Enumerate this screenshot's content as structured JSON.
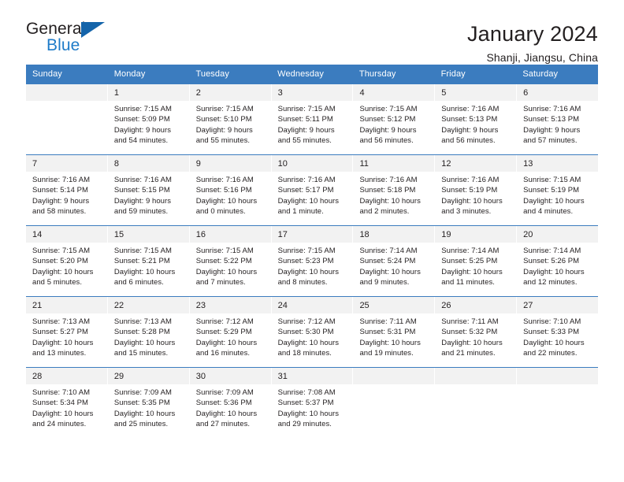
{
  "brand": {
    "name_part1": "General",
    "name_part2": "Blue",
    "triangle_color": "#1464aa",
    "blue_color": "#1e7bc8"
  },
  "header": {
    "title": "January 2024",
    "subtitle": "Shanji, Jiangsu, China"
  },
  "theme": {
    "header_blue": "#3b7cbf",
    "day_band_gray": "#f2f2f2",
    "text_color": "#231f20"
  },
  "weekdays": [
    "Sunday",
    "Monday",
    "Tuesday",
    "Wednesday",
    "Thursday",
    "Friday",
    "Saturday"
  ],
  "weeks": [
    [
      {
        "day": "",
        "sunrise": "",
        "sunset": "",
        "daylight_line1": "",
        "daylight_line2": ""
      },
      {
        "day": "1",
        "sunrise": "Sunrise: 7:15 AM",
        "sunset": "Sunset: 5:09 PM",
        "daylight_line1": "Daylight: 9 hours",
        "daylight_line2": "and 54 minutes."
      },
      {
        "day": "2",
        "sunrise": "Sunrise: 7:15 AM",
        "sunset": "Sunset: 5:10 PM",
        "daylight_line1": "Daylight: 9 hours",
        "daylight_line2": "and 55 minutes."
      },
      {
        "day": "3",
        "sunrise": "Sunrise: 7:15 AM",
        "sunset": "Sunset: 5:11 PM",
        "daylight_line1": "Daylight: 9 hours",
        "daylight_line2": "and 55 minutes."
      },
      {
        "day": "4",
        "sunrise": "Sunrise: 7:15 AM",
        "sunset": "Sunset: 5:12 PM",
        "daylight_line1": "Daylight: 9 hours",
        "daylight_line2": "and 56 minutes."
      },
      {
        "day": "5",
        "sunrise": "Sunrise: 7:16 AM",
        "sunset": "Sunset: 5:13 PM",
        "daylight_line1": "Daylight: 9 hours",
        "daylight_line2": "and 56 minutes."
      },
      {
        "day": "6",
        "sunrise": "Sunrise: 7:16 AM",
        "sunset": "Sunset: 5:13 PM",
        "daylight_line1": "Daylight: 9 hours",
        "daylight_line2": "and 57 minutes."
      }
    ],
    [
      {
        "day": "7",
        "sunrise": "Sunrise: 7:16 AM",
        "sunset": "Sunset: 5:14 PM",
        "daylight_line1": "Daylight: 9 hours",
        "daylight_line2": "and 58 minutes."
      },
      {
        "day": "8",
        "sunrise": "Sunrise: 7:16 AM",
        "sunset": "Sunset: 5:15 PM",
        "daylight_line1": "Daylight: 9 hours",
        "daylight_line2": "and 59 minutes."
      },
      {
        "day": "9",
        "sunrise": "Sunrise: 7:16 AM",
        "sunset": "Sunset: 5:16 PM",
        "daylight_line1": "Daylight: 10 hours",
        "daylight_line2": "and 0 minutes."
      },
      {
        "day": "10",
        "sunrise": "Sunrise: 7:16 AM",
        "sunset": "Sunset: 5:17 PM",
        "daylight_line1": "Daylight: 10 hours",
        "daylight_line2": "and 1 minute."
      },
      {
        "day": "11",
        "sunrise": "Sunrise: 7:16 AM",
        "sunset": "Sunset: 5:18 PM",
        "daylight_line1": "Daylight: 10 hours",
        "daylight_line2": "and 2 minutes."
      },
      {
        "day": "12",
        "sunrise": "Sunrise: 7:16 AM",
        "sunset": "Sunset: 5:19 PM",
        "daylight_line1": "Daylight: 10 hours",
        "daylight_line2": "and 3 minutes."
      },
      {
        "day": "13",
        "sunrise": "Sunrise: 7:15 AM",
        "sunset": "Sunset: 5:19 PM",
        "daylight_line1": "Daylight: 10 hours",
        "daylight_line2": "and 4 minutes."
      }
    ],
    [
      {
        "day": "14",
        "sunrise": "Sunrise: 7:15 AM",
        "sunset": "Sunset: 5:20 PM",
        "daylight_line1": "Daylight: 10 hours",
        "daylight_line2": "and 5 minutes."
      },
      {
        "day": "15",
        "sunrise": "Sunrise: 7:15 AM",
        "sunset": "Sunset: 5:21 PM",
        "daylight_line1": "Daylight: 10 hours",
        "daylight_line2": "and 6 minutes."
      },
      {
        "day": "16",
        "sunrise": "Sunrise: 7:15 AM",
        "sunset": "Sunset: 5:22 PM",
        "daylight_line1": "Daylight: 10 hours",
        "daylight_line2": "and 7 minutes."
      },
      {
        "day": "17",
        "sunrise": "Sunrise: 7:15 AM",
        "sunset": "Sunset: 5:23 PM",
        "daylight_line1": "Daylight: 10 hours",
        "daylight_line2": "and 8 minutes."
      },
      {
        "day": "18",
        "sunrise": "Sunrise: 7:14 AM",
        "sunset": "Sunset: 5:24 PM",
        "daylight_line1": "Daylight: 10 hours",
        "daylight_line2": "and 9 minutes."
      },
      {
        "day": "19",
        "sunrise": "Sunrise: 7:14 AM",
        "sunset": "Sunset: 5:25 PM",
        "daylight_line1": "Daylight: 10 hours",
        "daylight_line2": "and 11 minutes."
      },
      {
        "day": "20",
        "sunrise": "Sunrise: 7:14 AM",
        "sunset": "Sunset: 5:26 PM",
        "daylight_line1": "Daylight: 10 hours",
        "daylight_line2": "and 12 minutes."
      }
    ],
    [
      {
        "day": "21",
        "sunrise": "Sunrise: 7:13 AM",
        "sunset": "Sunset: 5:27 PM",
        "daylight_line1": "Daylight: 10 hours",
        "daylight_line2": "and 13 minutes."
      },
      {
        "day": "22",
        "sunrise": "Sunrise: 7:13 AM",
        "sunset": "Sunset: 5:28 PM",
        "daylight_line1": "Daylight: 10 hours",
        "daylight_line2": "and 15 minutes."
      },
      {
        "day": "23",
        "sunrise": "Sunrise: 7:12 AM",
        "sunset": "Sunset: 5:29 PM",
        "daylight_line1": "Daylight: 10 hours",
        "daylight_line2": "and 16 minutes."
      },
      {
        "day": "24",
        "sunrise": "Sunrise: 7:12 AM",
        "sunset": "Sunset: 5:30 PM",
        "daylight_line1": "Daylight: 10 hours",
        "daylight_line2": "and 18 minutes."
      },
      {
        "day": "25",
        "sunrise": "Sunrise: 7:11 AM",
        "sunset": "Sunset: 5:31 PM",
        "daylight_line1": "Daylight: 10 hours",
        "daylight_line2": "and 19 minutes."
      },
      {
        "day": "26",
        "sunrise": "Sunrise: 7:11 AM",
        "sunset": "Sunset: 5:32 PM",
        "daylight_line1": "Daylight: 10 hours",
        "daylight_line2": "and 21 minutes."
      },
      {
        "day": "27",
        "sunrise": "Sunrise: 7:10 AM",
        "sunset": "Sunset: 5:33 PM",
        "daylight_line1": "Daylight: 10 hours",
        "daylight_line2": "and 22 minutes."
      }
    ],
    [
      {
        "day": "28",
        "sunrise": "Sunrise: 7:10 AM",
        "sunset": "Sunset: 5:34 PM",
        "daylight_line1": "Daylight: 10 hours",
        "daylight_line2": "and 24 minutes."
      },
      {
        "day": "29",
        "sunrise": "Sunrise: 7:09 AM",
        "sunset": "Sunset: 5:35 PM",
        "daylight_line1": "Daylight: 10 hours",
        "daylight_line2": "and 25 minutes."
      },
      {
        "day": "30",
        "sunrise": "Sunrise: 7:09 AM",
        "sunset": "Sunset: 5:36 PM",
        "daylight_line1": "Daylight: 10 hours",
        "daylight_line2": "and 27 minutes."
      },
      {
        "day": "31",
        "sunrise": "Sunrise: 7:08 AM",
        "sunset": "Sunset: 5:37 PM",
        "daylight_line1": "Daylight: 10 hours",
        "daylight_line2": "and 29 minutes."
      },
      {
        "day": "",
        "sunrise": "",
        "sunset": "",
        "daylight_line1": "",
        "daylight_line2": ""
      },
      {
        "day": "",
        "sunrise": "",
        "sunset": "",
        "daylight_line1": "",
        "daylight_line2": ""
      },
      {
        "day": "",
        "sunrise": "",
        "sunset": "",
        "daylight_line1": "",
        "daylight_line2": ""
      }
    ]
  ]
}
